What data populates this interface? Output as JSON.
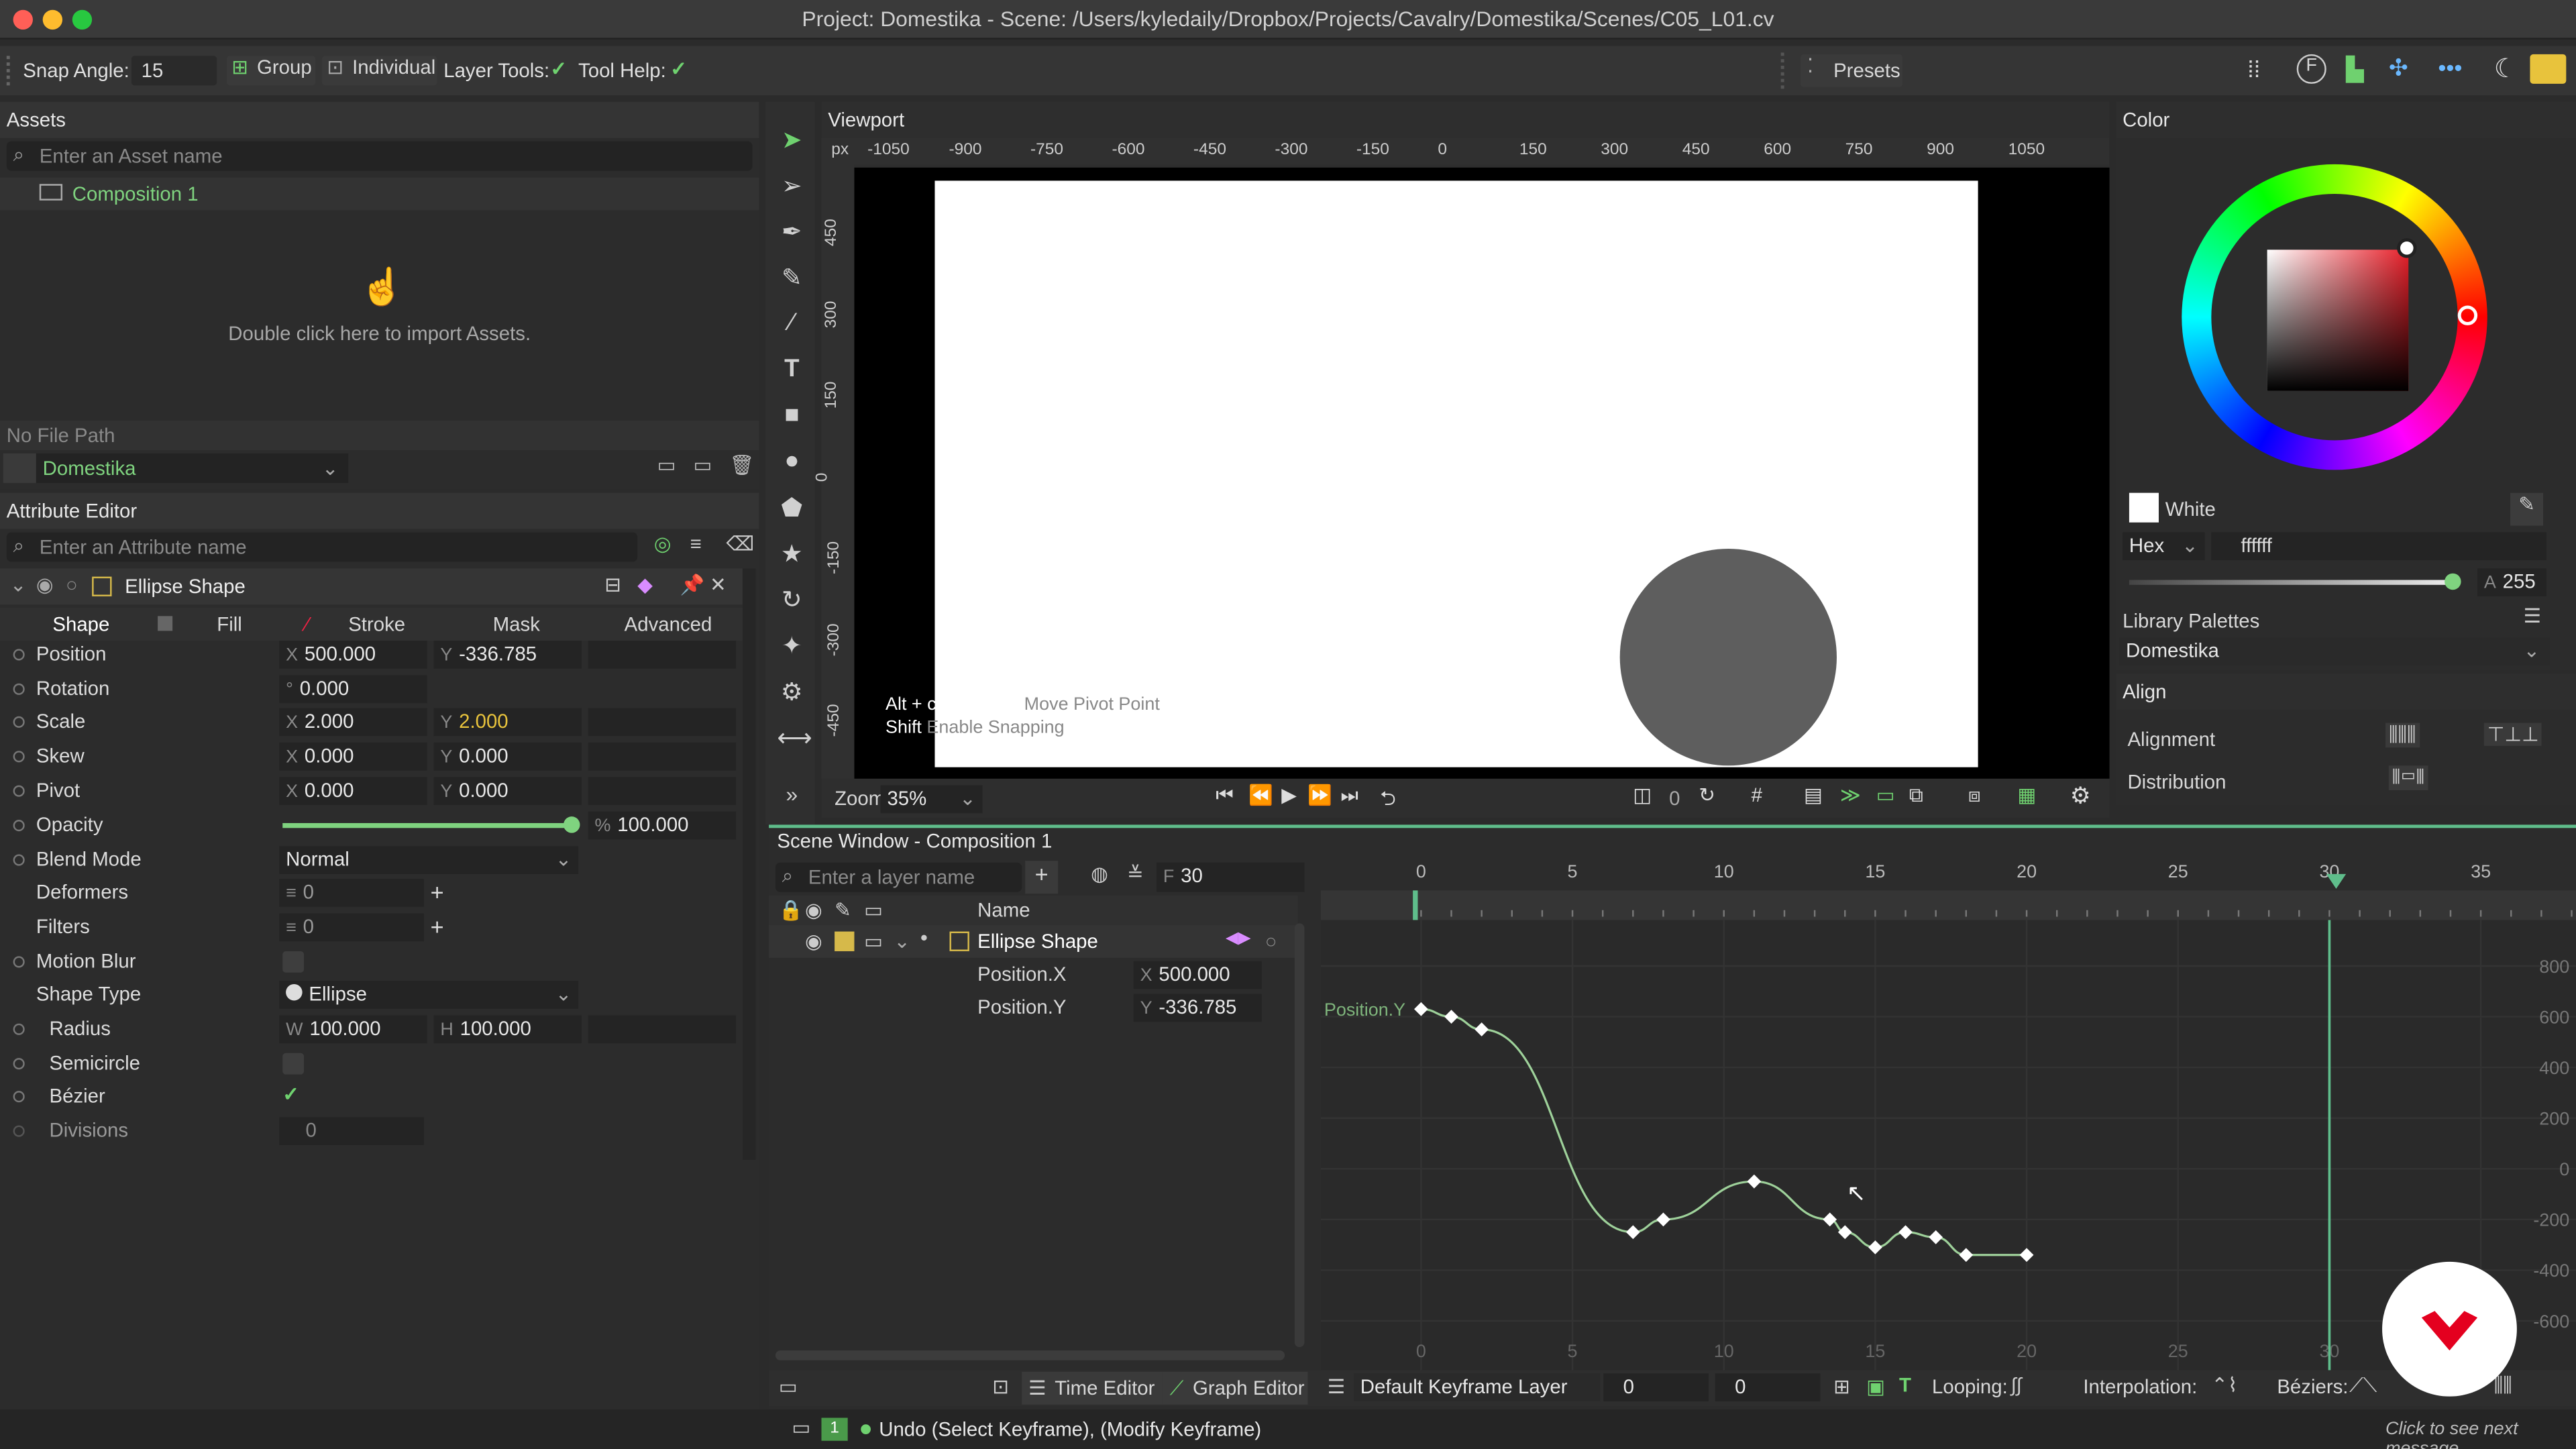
{
  "window": {
    "title": "Project: Domestika - Scene: /Users/kyledaily/Dropbox/Projects/Cavalry/Domestika/Scenes/C05_L01.cv"
  },
  "toolbar": {
    "snap_label": "Snap Angle:",
    "snap_value": "15",
    "group": "Group",
    "individual": "Individual",
    "layer_tools": "Layer Tools:",
    "tool_help": "Tool Help:",
    "presets": "Presets"
  },
  "assets": {
    "title": "Assets",
    "search_placeholder": "Enter an Asset name",
    "composition": "Composition 1",
    "import_hint": "Double click here to import Assets.",
    "file_path": "No File Path",
    "project": "Domestika"
  },
  "attribute_editor": {
    "title": "Attribute Editor",
    "search_placeholder": "Enter an Attribute name",
    "layer_name": "Ellipse Shape",
    "tabs": [
      "Shape",
      "Fill",
      "Stroke",
      "Mask",
      "Advanced"
    ],
    "rows": {
      "position": {
        "label": "Position",
        "x": "500.000",
        "y": "-336.785"
      },
      "rotation": {
        "label": "Rotation",
        "v": "0.000"
      },
      "scale": {
        "label": "Scale",
        "x": "2.000",
        "y": "2.000"
      },
      "skew": {
        "label": "Skew",
        "x": "0.000",
        "y": "0.000"
      },
      "pivot": {
        "label": "Pivot",
        "x": "0.000",
        "y": "0.000"
      },
      "opacity": {
        "label": "Opacity",
        "v": "100.000",
        "pct": "%"
      },
      "blend": {
        "label": "Blend Mode",
        "v": "Normal"
      },
      "deformers": {
        "label": "Deformers",
        "v": "0"
      },
      "filters": {
        "label": "Filters",
        "v": "0"
      },
      "motion_blur": {
        "label": "Motion Blur"
      },
      "shape_type": {
        "label": "Shape Type",
        "v": "Ellipse"
      },
      "radius": {
        "label": "Radius",
        "w": "100.000",
        "h": "100.000"
      },
      "semicircle": {
        "label": "Semicircle"
      },
      "bezier": {
        "label": "Bézier"
      },
      "divisions": {
        "label": "Divisions",
        "v": "0"
      }
    },
    "axis": {
      "x": "X",
      "y": "Y",
      "w": "W",
      "h": "H"
    }
  },
  "viewport": {
    "title": "Viewport",
    "unit": "px",
    "ruler_x": [
      "-1050",
      "-900",
      "-750",
      "-600",
      "-450",
      "-300",
      "-150",
      "0",
      "150",
      "300",
      "450",
      "600",
      "750",
      "900",
      "1050"
    ],
    "ruler_y": [
      "450",
      "300",
      "150",
      "0",
      "-150",
      "-300",
      "-450"
    ],
    "hint1_key": "Alt + click + drag",
    "hint1_text": "Move Pivot Point",
    "hint2_key": "Shift",
    "hint2_text": "Enable Snapping",
    "zoom_label": "Zoom",
    "zoom_value": "35%",
    "frame_value": "0"
  },
  "color": {
    "title": "Color",
    "name": "White",
    "mode": "Hex",
    "hex": "ffffff",
    "alpha_label": "A",
    "alpha": "255",
    "library_title": "Library Palettes",
    "library": "Domestika",
    "swatch": "#ffffff"
  },
  "align": {
    "title": "Align",
    "alignment": "Alignment",
    "distribution": "Distribution"
  },
  "scene": {
    "title": "Scene Window - Composition 1",
    "search_placeholder": "Enter a layer name",
    "frame_label": "F",
    "frame": "30",
    "col_name": "Name",
    "layers": [
      {
        "name": "Ellipse Shape"
      },
      {
        "name": "Position.X",
        "axis": "X",
        "value": "500.000"
      },
      {
        "name": "Position.Y",
        "axis": "Y",
        "value": "-336.785"
      }
    ],
    "time_ticks": [
      "0",
      "5",
      "10",
      "15",
      "20",
      "25",
      "30",
      "35"
    ],
    "value_ticks": [
      "800",
      "600",
      "400",
      "200",
      "0",
      "-200",
      "-400",
      "-600"
    ],
    "curve_label": "Position.Y"
  },
  "bottom": {
    "time_editor": "Time Editor",
    "graph_editor": "Graph Editor",
    "keyframe_layer": "Default Keyframe Layer",
    "v1": "0",
    "v2": "0",
    "looping": "Looping:",
    "interpolation": "Interpolation:",
    "beziers": "Béziers:"
  },
  "status": {
    "badge": "1",
    "message": "Undo (Select Keyframe), (Modify Keyframe)",
    "right": "Click to see next message"
  },
  "chart_data": {
    "type": "line",
    "title": "",
    "xlabel": "",
    "ylabel": "",
    "xlim": [
      0,
      35
    ],
    "ylim": [
      -600,
      800
    ],
    "series": [
      {
        "name": "Position.Y",
        "x": [
          0,
          1,
          2,
          7,
          8,
          11,
          13.5,
          14,
          15,
          16,
          17,
          18,
          20
        ],
        "values": [
          630,
          600,
          550,
          -250,
          -200,
          -50,
          -200,
          -250,
          -310,
          -250,
          -270,
          -340,
          -340
        ]
      }
    ]
  }
}
